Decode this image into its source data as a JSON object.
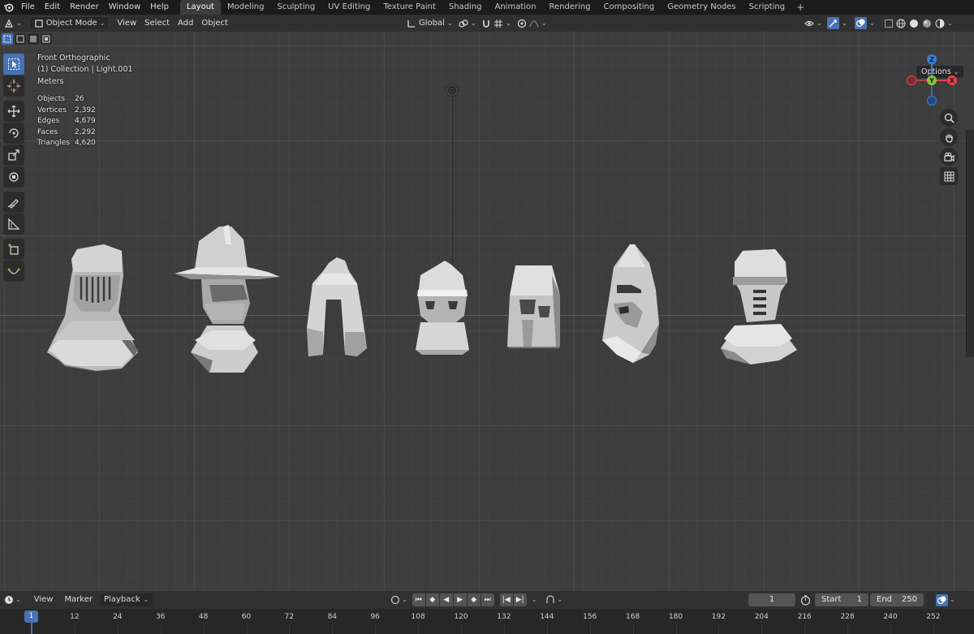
{
  "menubar": {
    "menus": [
      "File",
      "Edit",
      "Render",
      "Window",
      "Help"
    ],
    "workspaces": [
      "Layout",
      "Modeling",
      "Sculpting",
      "UV Editing",
      "Texture Paint",
      "Shading",
      "Animation",
      "Rendering",
      "Compositing",
      "Geometry Nodes",
      "Scripting"
    ],
    "active_workspace": "Layout",
    "add_tab_icon": "plus-icon"
  },
  "header": {
    "mode": "Object Mode",
    "menus": [
      "View",
      "Select",
      "Add",
      "Object"
    ],
    "transform_orientation": "Global",
    "options_label": "Options"
  },
  "viewport": {
    "view_name": "Front Orthographic",
    "collection": "(1) Collection | Light.001",
    "units": "Meters",
    "stats": [
      {
        "label": "Objects",
        "value": "26"
      },
      {
        "label": "Vertices",
        "value": "2,392"
      },
      {
        "label": "Edges",
        "value": "4,679"
      },
      {
        "label": "Faces",
        "value": "2,292"
      },
      {
        "label": "Triangles",
        "value": "4,620"
      }
    ],
    "gizmo_axes": {
      "z": "Z",
      "y": "Y",
      "x": "X"
    },
    "colors": {
      "x_axis": "#e8414d",
      "y_axis": "#8ac43f",
      "z_axis": "#3b7ed8",
      "accent": "#4772b3",
      "grid_bg": "#3d3d3d"
    }
  },
  "timeline": {
    "menus": [
      "View",
      "Marker",
      "Playback"
    ],
    "current_frame": "1",
    "start_label": "Start",
    "start_value": "1",
    "end_label": "End",
    "end_value": "250",
    "ruler_ticks": [
      "1",
      "12",
      "24",
      "36",
      "48",
      "60",
      "72",
      "84",
      "96",
      "108",
      "120",
      "132",
      "144",
      "156",
      "168",
      "180",
      "192",
      "204",
      "216",
      "228",
      "240",
      "252"
    ]
  }
}
